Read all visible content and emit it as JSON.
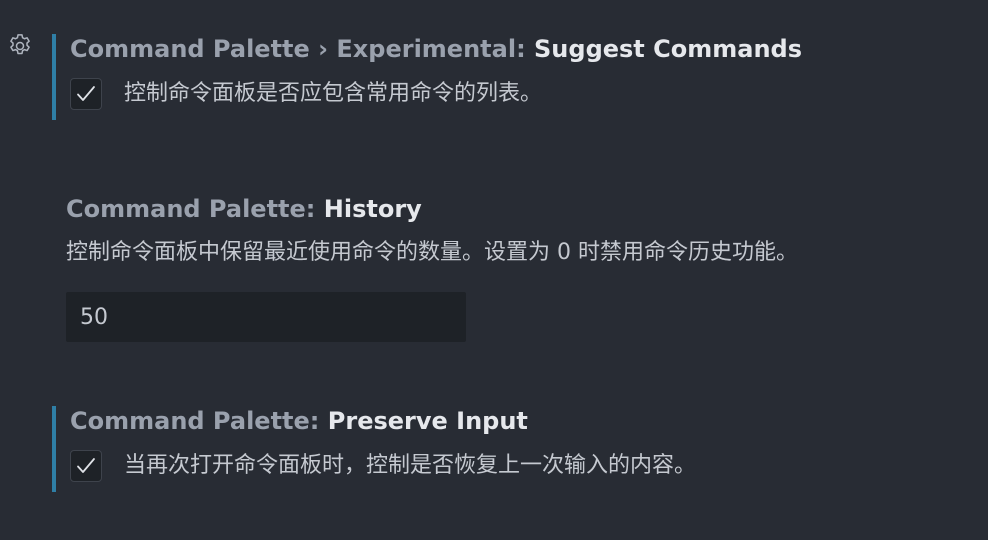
{
  "settings": [
    {
      "category": "Command Palette › Experimental: ",
      "name": "Suggest Commands",
      "description": "控制命令面板是否应包含常用命令的列表。",
      "checked": true
    },
    {
      "category": "Command Palette: ",
      "name": "History",
      "description": "控制命令面板中保留最近使用命令的数量。设置为 0 时禁用命令历史功能。",
      "value": "50"
    },
    {
      "category": "Command Palette: ",
      "name": "Preserve Input",
      "description": "当再次打开命令面板时，控制是否恢复上一次输入的内容。",
      "checked": true
    }
  ],
  "icons": {
    "gear": "gear-icon",
    "check": "checkmark-icon"
  },
  "colors": {
    "background": "#282c34",
    "modified_indicator": "#2f7fa6",
    "input_background": "#1e2227"
  }
}
